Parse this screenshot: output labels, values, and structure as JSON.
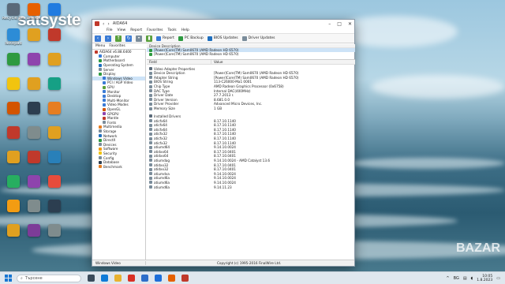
{
  "watermark": "satsyste",
  "corner_watermark": "BAZAR",
  "desktop_icons": [
    {
      "label": "Recycle Bin",
      "color": "#5a6a7a"
    },
    {
      "label": "Firefox",
      "color": "#e66000"
    },
    {
      "label": "",
      "color": "#1f7be0"
    },
    {
      "label": "Notepad",
      "color": "#2d8cd6"
    },
    {
      "label": "",
      "color": "#e0a020"
    },
    {
      "label": "",
      "color": "#c0392b"
    },
    {
      "label": "",
      "color": "#2e9a40"
    },
    {
      "label": "",
      "color": "#8e44ad"
    },
    {
      "label": "",
      "color": "#e0a020"
    },
    {
      "label": "",
      "color": "#f1c40f"
    },
    {
      "label": "",
      "color": "#e0a020"
    },
    {
      "label": "",
      "color": "#16a085"
    },
    {
      "label": "",
      "color": "#d35400"
    },
    {
      "label": "",
      "color": "#2c3e50"
    },
    {
      "label": "",
      "color": "#e67e22"
    },
    {
      "label": "",
      "color": "#c0392b"
    },
    {
      "label": "",
      "color": "#7f8c8d"
    },
    {
      "label": "",
      "color": "#e0a020"
    },
    {
      "label": "",
      "color": "#e0a020"
    },
    {
      "label": "",
      "color": "#c0392b"
    },
    {
      "label": "",
      "color": "#2980b9"
    },
    {
      "label": "",
      "color": "#27ae60"
    },
    {
      "label": "",
      "color": "#8e44ad"
    },
    {
      "label": "",
      "color": "#e74c3c"
    },
    {
      "label": "",
      "color": "#f39c12"
    },
    {
      "label": "",
      "color": "#7f8c8d"
    },
    {
      "label": "",
      "color": "#2c3e50"
    },
    {
      "label": "",
      "color": "#e0a020"
    },
    {
      "label": "",
      "color": "#7d3c98"
    },
    {
      "label": "",
      "color": "#7f8c8d"
    }
  ],
  "window": {
    "title": "AIDA64",
    "menu": [
      "File",
      "View",
      "Report",
      "Favorites",
      "Tools",
      "Help"
    ],
    "toolbar": {
      "report": "Report",
      "backup": "PC Backup",
      "bios": "BIOS Updates",
      "driver": "Driver Updates"
    },
    "tabs": [
      "Menu",
      "Favorites"
    ],
    "tree": [
      "AIDA64 v6.88.6400",
      "Computer",
      "Motherboard",
      "Operating System",
      "Server",
      "Display",
      "Windows Video",
      "PCI / AGP Video",
      "GPU",
      "Monitor",
      "Desktop",
      "Multi-Monitor",
      "Video Modes",
      "OpenGL",
      "GPGPU",
      "Mantle",
      "Fonts",
      "Multimedia",
      "Storage",
      "Network",
      "DirectX",
      "Devices",
      "Software",
      "Security",
      "Config",
      "Database",
      "Benchmark"
    ],
    "selected_tree_index": 6,
    "device_header": "Device Description",
    "devices": [
      "[Power]Core(TM) Sam0670 (AMD Radeon HD 6570)",
      "[Power]Core(TM) Sam0670 (AMD Radeon HD 6570)"
    ],
    "columns": {
      "field": "Field",
      "value": "Value"
    },
    "adapter_section": "Video Adapter Properties",
    "properties": [
      {
        "field": "Device Description",
        "value": "[Power]Core(TM) Sam0670 (AMD Radeon HD 6570)"
      },
      {
        "field": "Adapter String",
        "value": "[Power]Core(TM) Sam0670 (AMD Radeon HD 6570)"
      },
      {
        "field": "BIOS String",
        "value": "113-C26000-Ma1 0001"
      },
      {
        "field": "Chip Type",
        "value": "AMD Radeon Graphics Processor (0x6758)"
      },
      {
        "field": "DAC Type",
        "value": "Internal DAC(400MHz)"
      },
      {
        "field": "Driver Date",
        "value": "27.7.2013 r."
      },
      {
        "field": "Driver Version",
        "value": "8.681.0.0"
      },
      {
        "field": "Driver Provider",
        "value": "Advanced Micro Devices, Inc."
      },
      {
        "field": "Memory Size",
        "value": "1 GB"
      }
    ],
    "drivers_section": "Installed Drivers",
    "drivers": [
      {
        "name": "aticfx64",
        "version": "8.17.10.1140"
      },
      {
        "name": "aticfx64",
        "version": "8.17.10.1140"
      },
      {
        "name": "aticfx64",
        "version": "8.17.10.1140"
      },
      {
        "name": "aticfx32",
        "version": "8.17.10.1140"
      },
      {
        "name": "aticfx32",
        "version": "8.17.10.1140"
      },
      {
        "name": "aticfx32",
        "version": "8.17.10.1140"
      },
      {
        "name": "atiumd64",
        "version": "9.14.10.0024"
      },
      {
        "name": "atidxx64",
        "version": "8.17.10.0401"
      },
      {
        "name": "atidxx64",
        "version": "8.17.10.0401"
      },
      {
        "name": "atiumdag",
        "version": "9.14.10.0024 - AMD Catalyst 13.6"
      },
      {
        "name": "atidxx32",
        "version": "8.17.10.0401"
      },
      {
        "name": "atidxx32",
        "version": "8.17.10.0401"
      },
      {
        "name": "atiumdva",
        "version": "9.14.10.0024"
      },
      {
        "name": "atiumd6a",
        "version": "9.14.10.0024"
      },
      {
        "name": "atiumd6a",
        "version": "9.14.10.0024"
      },
      {
        "name": "atiumd6a",
        "version": "9.14.11.23"
      }
    ],
    "status_left": "Windows Video",
    "status_right": "Copyright (c) 1995-2016 FinalWire Ltd."
  },
  "taskbar": {
    "search_placeholder": "Търсене",
    "apps": [
      {
        "name": "task-view",
        "color": "#3b4b5b"
      },
      {
        "name": "edge",
        "color": "#0f7bd7"
      },
      {
        "name": "explorer",
        "color": "#e8b230"
      },
      {
        "name": "chrome",
        "color": "#d93025"
      },
      {
        "name": "store",
        "color": "#2d6ec9"
      },
      {
        "name": "mail",
        "color": "#1e6fd9"
      },
      {
        "name": "firefox",
        "color": "#e66000"
      },
      {
        "name": "aida64",
        "color": "#c0392b"
      }
    ],
    "tray_lang": "BG",
    "time": "10:05",
    "date": "1.8.2023"
  }
}
